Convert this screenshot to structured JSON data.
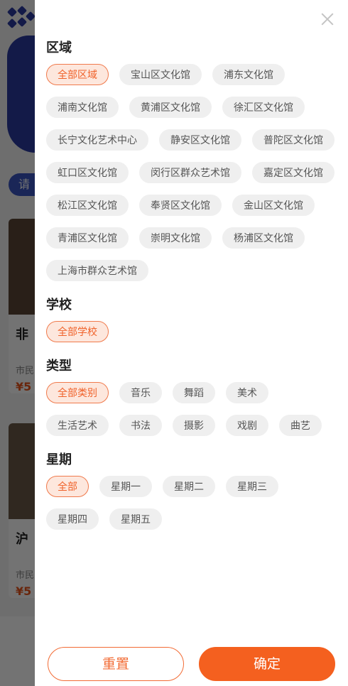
{
  "background": {
    "search_pill": "请",
    "cards": [
      {
        "title": "非",
        "meta": "市民",
        "price": "¥5"
      },
      {
        "title": "沪",
        "meta": "市民",
        "price": "¥5"
      }
    ]
  },
  "filter": {
    "sections": [
      {
        "title": "区域",
        "tags": [
          "全部区域",
          "宝山区文化馆",
          "浦东文化馆",
          "浦南文化馆",
          "黄浦区文化馆",
          "徐汇区文化馆",
          "长宁文化艺术中心",
          "静安区文化馆",
          "普陀区文化馆",
          "虹口区文化馆",
          "闵行区群众艺术馆",
          "嘉定区文化馆",
          "松江区文化馆",
          "奉贤区文化馆",
          "金山区文化馆",
          "青浦区文化馆",
          "崇明文化馆",
          "杨浦区文化馆",
          "上海市群众艺术馆"
        ],
        "selected": 0
      },
      {
        "title": "学校",
        "tags": [
          "全部学校"
        ],
        "selected": 0
      },
      {
        "title": "类型",
        "tags": [
          "全部类别",
          "音乐",
          "舞蹈",
          "美术",
          "生活艺术",
          "书法",
          "摄影",
          "戏剧",
          "曲艺"
        ],
        "selected": 0
      },
      {
        "title": "星期",
        "tags": [
          "全部",
          "星期一",
          "星期二",
          "星期三",
          "星期四",
          "星期五"
        ],
        "selected": 0
      }
    ],
    "reset_label": "重置",
    "confirm_label": "确定"
  },
  "colors": {
    "accent": "#f4601f",
    "active_tag_bg": "#fde7dd",
    "tag_bg": "#efefef"
  }
}
